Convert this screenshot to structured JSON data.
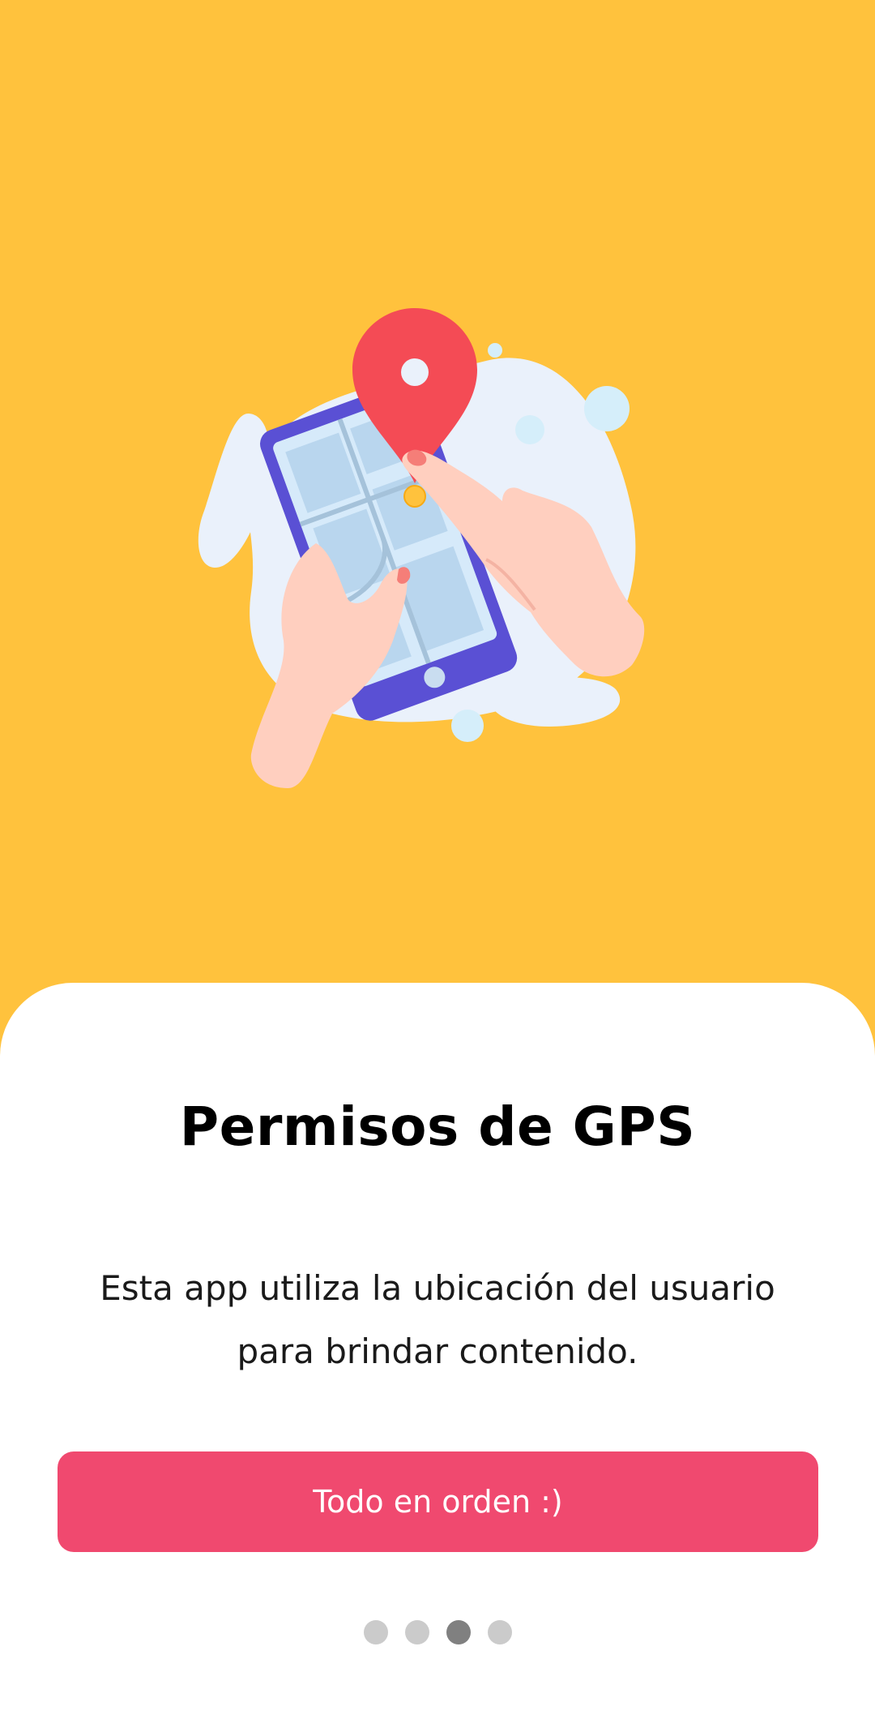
{
  "screen": {
    "title": "Permisos de GPS",
    "description": "Esta app utiliza la ubicación del usuario para brindar contenido.",
    "primary_button": "Todo en orden :)",
    "illustration": "phone-map-location-pin-illustration"
  },
  "pagination": {
    "total_pages": 4,
    "current_page": 3
  },
  "colors": {
    "background": "#FFC23D",
    "sheet": "#FFFFFF",
    "button": "#F0496F",
    "button_text": "#FFFFFF",
    "dot_inactive": "#CBCBCB",
    "dot_active": "#808080",
    "pin": "#F44B55",
    "phone_frame": "#5A50D4"
  }
}
